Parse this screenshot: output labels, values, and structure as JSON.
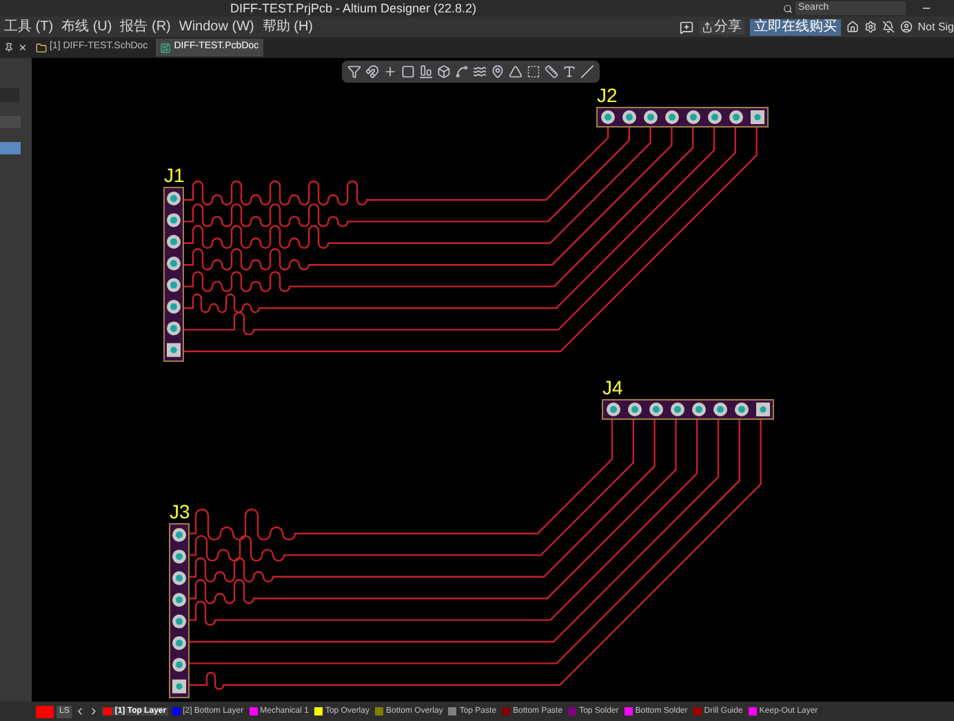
{
  "window": {
    "title": "DIFF-TEST.PrjPcb - Altium Designer (22.8.2)",
    "search": {
      "placeholder": "Search"
    }
  },
  "menu": [
    "工具 (T)",
    "布线 (U)",
    "报告 (R)",
    "Window (W)",
    "帮助 (H)"
  ],
  "header_actions": {
    "share": "分享",
    "buy": "立即在线购买",
    "account": "Not Sig"
  },
  "tabs": [
    {
      "label": "[1] DIFF-TEST.SchDoc",
      "kind": "sch",
      "selected": false
    },
    {
      "label": "DIFF-TEST.PcbDoc",
      "kind": "pcb",
      "selected": true
    }
  ],
  "left_panel": {
    "items": [
      {
        "selected": false
      },
      {
        "selected": true
      }
    ]
  },
  "components": [
    {
      "designator": "J1",
      "kind": "vertical"
    },
    {
      "designator": "J2",
      "kind": "horizontal"
    },
    {
      "designator": "J3",
      "kind": "vertical"
    },
    {
      "designator": "J4",
      "kind": "horizontal"
    }
  ],
  "status_bar": {
    "ls": "LS",
    "layers": [
      {
        "label": "[1] Top Layer",
        "color": "#ff0000",
        "selected": true
      },
      {
        "label": "[2] Bottom Layer",
        "color": "#0000ff",
        "selected": false
      },
      {
        "label": "Mechanical 1",
        "color": "#ff00ff",
        "selected": false
      },
      {
        "label": "Top Overlay",
        "color": "#ffff00",
        "selected": false
      },
      {
        "label": "Bottom Overlay",
        "color": "#808000",
        "selected": false
      },
      {
        "label": "Top Paste",
        "color": "#808080",
        "selected": false
      },
      {
        "label": "Bottom Paste",
        "color": "#800000",
        "selected": false
      },
      {
        "label": "Top Solder",
        "color": "#800080",
        "selected": false
      },
      {
        "label": "Bottom Solder",
        "color": "#ff00ff",
        "selected": false
      },
      {
        "label": "Drill Guide",
        "color": "#a00000",
        "selected": false
      },
      {
        "label": "Keep-Out Layer",
        "color": "#ff00ff",
        "selected": false
      }
    ]
  }
}
